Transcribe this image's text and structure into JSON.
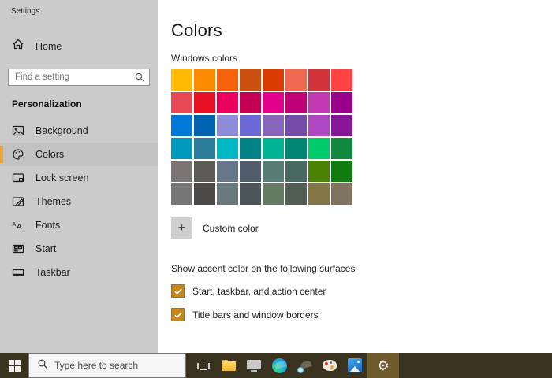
{
  "window": {
    "title": "Settings"
  },
  "sidebar": {
    "home": {
      "label": "Home"
    },
    "search": {
      "placeholder": "Find a setting"
    },
    "section_heading": "Personalization",
    "items": [
      {
        "label": "Background",
        "icon": "background-image-icon",
        "selected": false
      },
      {
        "label": "Colors",
        "icon": "colors-palette-icon",
        "selected": true
      },
      {
        "label": "Lock screen",
        "icon": "lock-screen-icon",
        "selected": false
      },
      {
        "label": "Themes",
        "icon": "themes-icon",
        "selected": false
      },
      {
        "label": "Fonts",
        "icon": "fonts-icon",
        "selected": false
      },
      {
        "label": "Start",
        "icon": "start-menu-icon",
        "selected": false
      },
      {
        "label": "Taskbar",
        "icon": "taskbar-item-icon",
        "selected": false
      }
    ]
  },
  "main": {
    "title": "Colors",
    "swatch_section_label": "Windows colors",
    "swatches": [
      "#ffb900",
      "#ff8c00",
      "#f7630c",
      "#ca5010",
      "#da3b01",
      "#ef6950",
      "#d13438",
      "#ff4343",
      "#e74856",
      "#e81123",
      "#ea005e",
      "#c30052",
      "#e3008c",
      "#bf0077",
      "#c239b3",
      "#9a0089",
      "#0078d7",
      "#0063b1",
      "#8e8cd8",
      "#6b69d6",
      "#8764b8",
      "#744da9",
      "#b146c2",
      "#881798",
      "#0099bc",
      "#2d7d9a",
      "#00b7c3",
      "#038387",
      "#00b294",
      "#018574",
      "#00cc6a",
      "#10893e",
      "#7a7574",
      "#5d5a58",
      "#68768a",
      "#515c6b",
      "#567c73",
      "#486860",
      "#498205",
      "#107c10",
      "#767676",
      "#4c4a48",
      "#69797e",
      "#4a5459",
      "#647c64",
      "#525e54",
      "#847545",
      "#7e735f"
    ],
    "custom_color": {
      "button_glyph": "+",
      "label": "Custom color"
    },
    "accent_surfaces": {
      "heading": "Show accent color on the following surfaces",
      "options": [
        {
          "label": "Start, taskbar, and action center",
          "checked": true
        },
        {
          "label": "Title bars and window borders",
          "checked": true
        }
      ]
    }
  },
  "taskbar": {
    "search_placeholder": "Type here to search",
    "active_app": "settings",
    "apps": [
      "start",
      "search",
      "task-view",
      "file-explorer",
      "system-monitor",
      "edge",
      "edge-beta",
      "paint-3d",
      "photos",
      "settings"
    ]
  },
  "colors": {
    "accent_checkbox": "#c8861d",
    "sidebar_selection_bar": "#e8a33a",
    "sidebar_bg": "#cbcbcb",
    "taskbar_bg": "#38321f",
    "taskbar_active_bg": "#6e5a2b"
  }
}
